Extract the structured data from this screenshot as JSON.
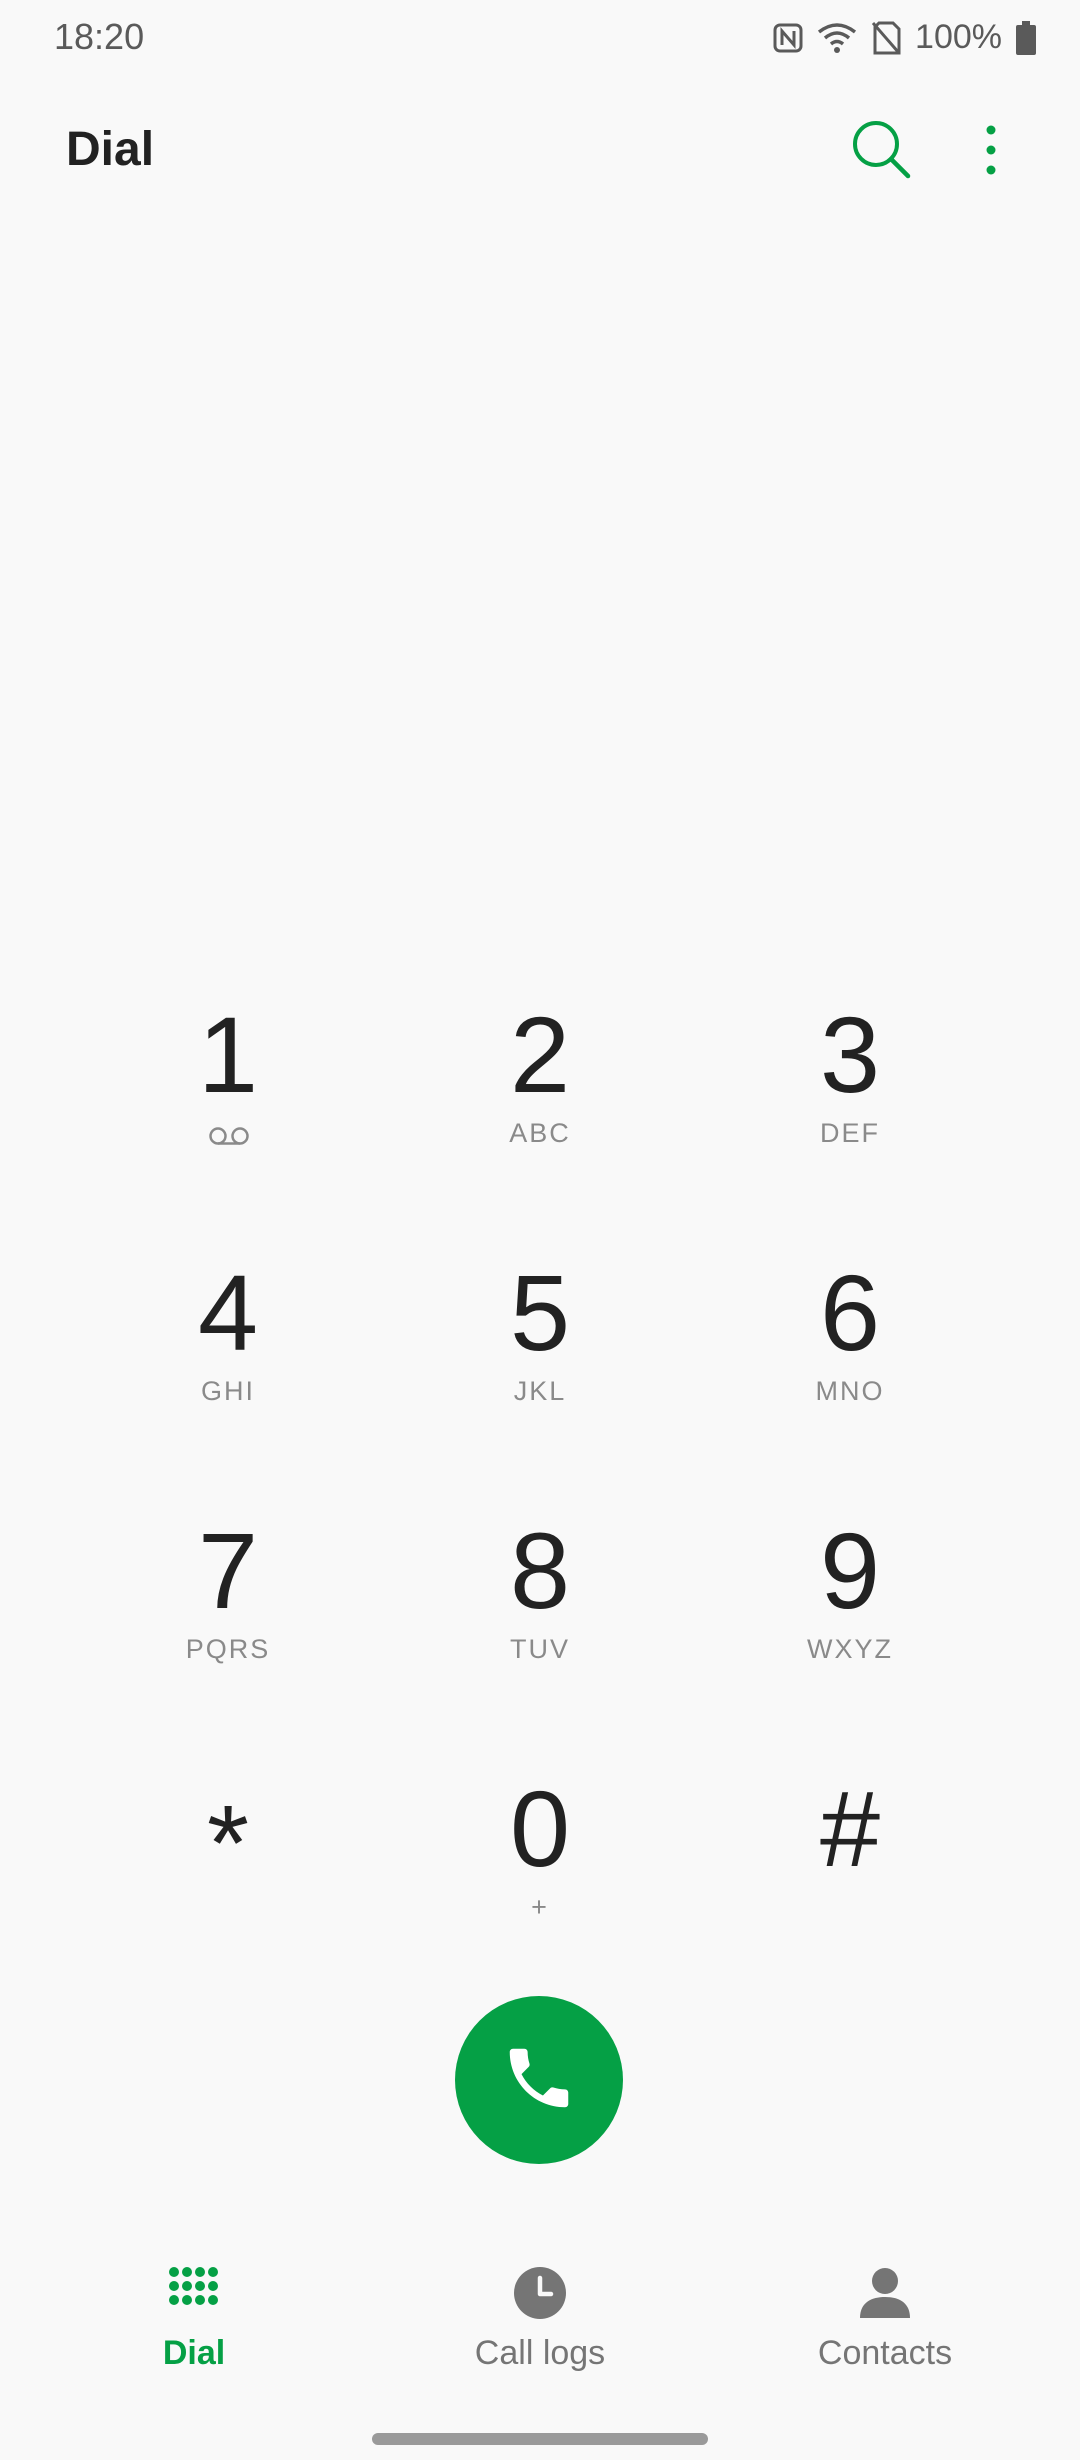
{
  "status_bar": {
    "time": "18:20",
    "battery": "100%",
    "icons": [
      "nfc-icon",
      "wifi-icon",
      "no-sim-icon",
      "battery-icon"
    ]
  },
  "header": {
    "title": "Dial",
    "search_icon": "search-icon",
    "more_icon": "more-vert-icon"
  },
  "keypad": {
    "keys": [
      {
        "digit": "1",
        "letters": "",
        "icon": "voicemail-icon"
      },
      {
        "digit": "2",
        "letters": "ABC"
      },
      {
        "digit": "3",
        "letters": "DEF"
      },
      {
        "digit": "4",
        "letters": "GHI"
      },
      {
        "digit": "5",
        "letters": "JKL"
      },
      {
        "digit": "6",
        "letters": "MNO"
      },
      {
        "digit": "7",
        "letters": "PQRS"
      },
      {
        "digit": "8",
        "letters": "TUV"
      },
      {
        "digit": "9",
        "letters": "WXYZ"
      },
      {
        "digit": "*",
        "letters": ""
      },
      {
        "digit": "0",
        "letters": "+"
      },
      {
        "digit": "#",
        "letters": ""
      }
    ]
  },
  "call_button": {
    "icon": "phone-icon"
  },
  "bottom_nav": {
    "items": [
      {
        "label": "Dial",
        "icon": "dialpad-icon",
        "active": true
      },
      {
        "label": "Call logs",
        "icon": "clock-icon",
        "active": false
      },
      {
        "label": "Contacts",
        "icon": "person-icon",
        "active": false
      }
    ]
  },
  "colors": {
    "accent": "#05a045",
    "background": "#f9f9f9",
    "text_primary": "#222222",
    "text_secondary": "#8a8a8a"
  }
}
